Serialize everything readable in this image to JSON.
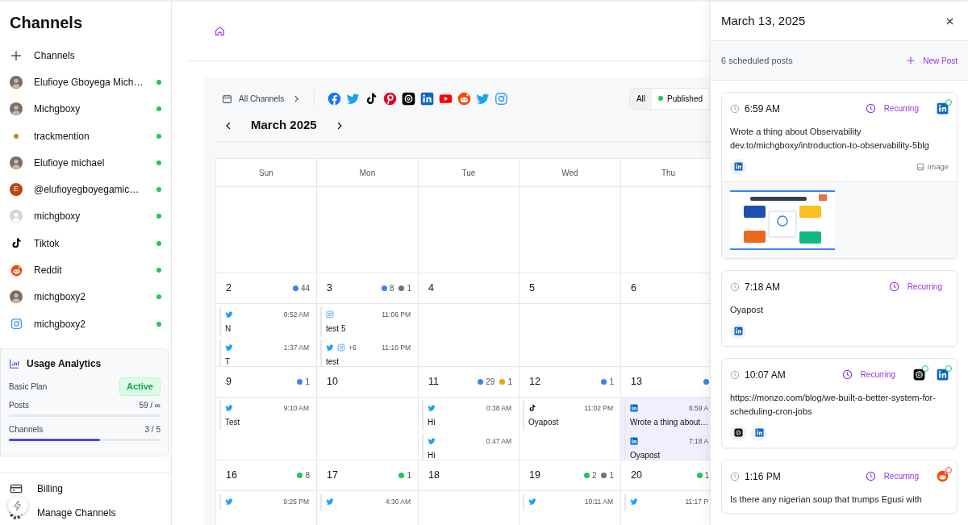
{
  "sidebar": {
    "title": "Channels",
    "items": [
      {
        "kind": "add",
        "label": "Channels"
      },
      {
        "label": "Elufioye Gboyega Mich…",
        "connected": true
      },
      {
        "label": "Michgboxy",
        "connected": true
      },
      {
        "kind": "logo",
        "label": "trackmention",
        "connected": true
      },
      {
        "label": "Elufioye michael",
        "connected": true
      },
      {
        "kind": "letter",
        "letter": "E",
        "label": "@elufioyegboyegamic…",
        "connected": true
      },
      {
        "kind": "placeholder",
        "label": "michgboxy",
        "connected": true
      },
      {
        "kind": "tiktok",
        "label": "Tiktok",
        "connected": true
      },
      {
        "kind": "reddit",
        "label": "Reddit",
        "connected": true
      },
      {
        "label": "michgboxy2",
        "connected": true
      },
      {
        "kind": "instagram",
        "label": "michgboxy2",
        "connected": true
      }
    ],
    "usage": {
      "title": "Usage Analytics",
      "plan": "Basic Plan",
      "plan_status": "Active",
      "meters": [
        {
          "label": "Posts",
          "reading": "59 / ∞",
          "level": 0
        },
        {
          "label": "Channels",
          "reading": "3 / 5",
          "level": 0.6
        }
      ]
    },
    "bottom_nav": [
      {
        "kind": "billing",
        "label": "Billing"
      },
      {
        "kind": "manage",
        "label": "Manage Channels"
      }
    ]
  },
  "calendar": {
    "channel_filter": "All Channels",
    "platforms": [
      {
        "kind": "facebook"
      },
      {
        "kind": "twitter"
      },
      {
        "kind": "tiktok"
      },
      {
        "kind": "pinterest"
      },
      {
        "kind": "threads"
      },
      {
        "kind": "linkedin"
      },
      {
        "kind": "youtube"
      },
      {
        "kind": "reddit"
      },
      {
        "kind": "twitter"
      },
      {
        "kind": "instagram"
      }
    ],
    "status_filters": [
      {
        "label": "All",
        "selected": true
      },
      {
        "label": "Published",
        "selected": false,
        "color": "#22c55e"
      }
    ],
    "month": "March 2025",
    "weekdays": [
      "Sun",
      "Mon",
      "Tue",
      "Wed",
      "Thu"
    ],
    "weeks": [
      {
        "days": [
          {
            "number": "2",
            "selected": false,
            "counts": [
              {
                "color": "#3b82f6",
                "count": "44"
              }
            ],
            "posts": [
              {
                "platforms": [
                  {
                    "kind": "twitter"
                  }
                ],
                "time": "0:52 AM",
                "text": "N"
              },
              {
                "platforms": [
                  {
                    "kind": "twitter"
                  }
                ],
                "time": "1:37 AM",
                "text": "T"
              }
            ]
          },
          {
            "number": "3",
            "selected": false,
            "counts": [
              {
                "color": "#3b82f6",
                "count": "8"
              },
              {
                "color": "#6b7280",
                "count": "1"
              }
            ],
            "posts": [
              {
                "platforms": [
                  {
                    "kind": "instagram"
                  }
                ],
                "time": "11:06 PM",
                "text": "test 5"
              },
              {
                "platforms": [
                  {
                    "kind": "twitter"
                  },
                  {
                    "kind": "instagram"
                  }
                ],
                "extra": "+6",
                "time": "11:10 PM",
                "text": "test"
              }
            ]
          },
          {
            "number": "4",
            "selected": false
          },
          {
            "number": "5",
            "selected": false
          },
          {
            "number": "6",
            "selected": false
          }
        ]
      },
      {
        "days": [
          {
            "number": "9",
            "selected": false,
            "counts": [
              {
                "color": "#3b82f6",
                "count": "1"
              }
            ],
            "posts": [
              {
                "platforms": [
                  {
                    "kind": "twitter"
                  }
                ],
                "time": "9:10 AM",
                "text": "Test"
              }
            ]
          },
          {
            "number": "10",
            "selected": false
          },
          {
            "number": "11",
            "selected": false,
            "counts": [
              {
                "color": "#3b82f6",
                "count": "29"
              },
              {
                "color": "#f59e0b",
                "count": "1"
              }
            ],
            "posts": [
              {
                "platforms": [
                  {
                    "kind": "twitter"
                  }
                ],
                "time": "0:38 AM",
                "text": "Hi"
              },
              {
                "platforms": [
                  {
                    "kind": "twitter"
                  }
                ],
                "time": "0:47 AM",
                "text": "Hi"
              }
            ]
          },
          {
            "number": "12",
            "selected": false,
            "counts": [
              {
                "color": "#3b82f6",
                "count": "1"
              }
            ],
            "posts": [
              {
                "platforms": [
                  {
                    "kind": "tiktok"
                  }
                ],
                "time": "11:02 PM",
                "text": "Oyapost"
              }
            ]
          },
          {
            "number": "13",
            "selected": true,
            "counts": [
              {
                "color": "#3b82f6"
              }
            ],
            "posts": [
              {
                "platforms": [
                  {
                    "kind": "linkedin"
                  }
                ],
                "time": "6:59 A",
                "text": "Wrote a thing about…"
              },
              {
                "platforms": [
                  {
                    "kind": "linkedin"
                  }
                ],
                "time": "7:18 A",
                "text": "Oyapost"
              }
            ]
          }
        ]
      },
      {
        "days": [
          {
            "number": "16",
            "selected": false,
            "counts": [
              {
                "color": "#22c55e",
                "count": "8"
              }
            ],
            "posts": [
              {
                "platforms": [
                  {
                    "kind": "twitter"
                  }
                ],
                "time": "9:25 PM"
              }
            ]
          },
          {
            "number": "17",
            "selected": false,
            "counts": [
              {
                "color": "#22c55e",
                "count": "1"
              }
            ],
            "posts": [
              {
                "platforms": [
                  {
                    "kind": "twitter"
                  }
                ],
                "time": "4:30 AM"
              }
            ]
          },
          {
            "number": "18",
            "selected": false
          },
          {
            "number": "19",
            "selected": false,
            "counts": [
              {
                "color": "#22c55e",
                "count": "2"
              },
              {
                "color": "#6b7280",
                "count": "1"
              }
            ],
            "posts": [
              {
                "platforms": [
                  {
                    "kind": "twitter"
                  }
                ],
                "time": "10:11 AM"
              }
            ]
          },
          {
            "number": "20",
            "selected": false,
            "counts": [
              {
                "color": "#22c55e",
                "count": "1"
              }
            ],
            "posts": [
              {
                "platforms": [
                  {
                    "kind": "twitter"
                  }
                ],
                "time": "11:17 P"
              }
            ]
          }
        ]
      }
    ]
  },
  "panel": {
    "date": "March 13, 2025",
    "count_label": "6 scheduled posts",
    "new_post": "New Post",
    "posts": [
      {
        "time": "6:59 AM",
        "recurring": "Recurring",
        "targets": [
          {
            "kind": "linkedin",
            "published": true
          }
        ],
        "text": "Wrote a thing about Observability\ndev.to/michgboxy/introduction-to-observability-5blg",
        "platforms": [
          {
            "kind": "linkedin"
          }
        ],
        "attachment": "Image",
        "preview": {
          "kind": "picture"
        }
      },
      {
        "time": "7:18 AM",
        "recurring": "Recurring",
        "text": "Oyapost",
        "platforms": [
          {
            "kind": "linkedin"
          }
        ]
      },
      {
        "time": "10:07 AM",
        "recurring": "Recurring",
        "targets": [
          {
            "kind": "threads",
            "published": true
          },
          {
            "kind": "linkedin",
            "published": true
          }
        ],
        "text": "https://monzo.com/blog/we-built-a-better-system-for-scheduling-cron-jobs",
        "platforms": [
          {
            "kind": "threads"
          },
          {
            "kind": "linkedin"
          }
        ]
      },
      {
        "time": "1:16 PM",
        "recurring": "Recurring",
        "targets": [
          {
            "kind": "reddit",
            "published": false
          }
        ],
        "text": "Is there any nigerian soup that trumps Egusi with"
      }
    ]
  }
}
